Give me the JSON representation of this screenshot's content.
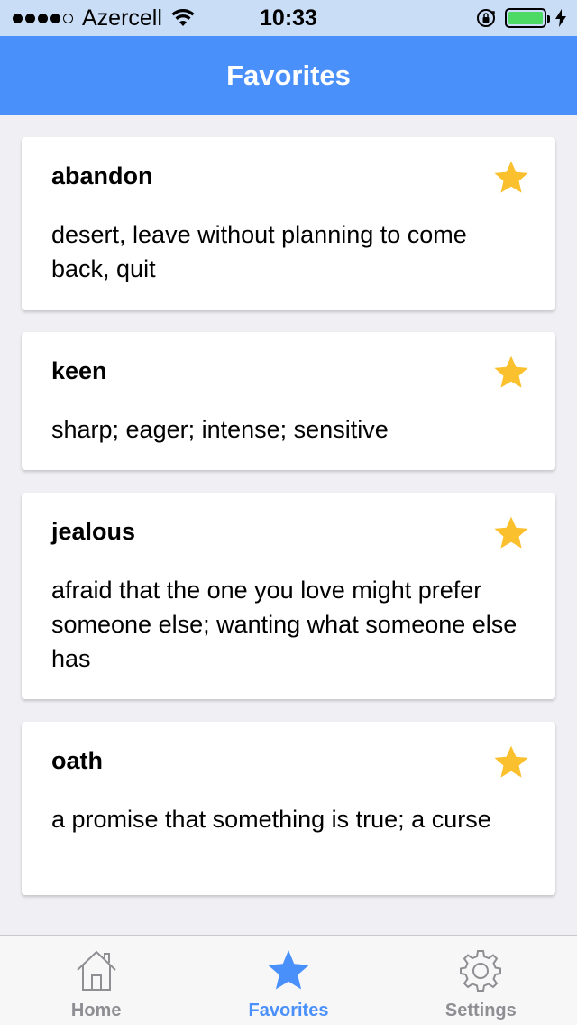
{
  "status_bar": {
    "carrier": "Azercell",
    "time": "10:33",
    "signal_bars": 4,
    "signal_total": 5,
    "battery_level": 1.0
  },
  "nav": {
    "title": "Favorites"
  },
  "cards": [
    {
      "word": "abandon",
      "definition": "desert, leave without planning to come back, quit",
      "favorite": true
    },
    {
      "word": "keen",
      "definition": "sharp; eager; intense; sensitive",
      "favorite": true
    },
    {
      "word": "jealous",
      "definition": "afraid that the one you love might prefer someone else; wanting what someone else has",
      "favorite": true
    },
    {
      "word": "oath",
      "definition": "a promise that something is true; a curse",
      "favorite": true
    }
  ],
  "tabs": [
    {
      "label": "Home",
      "icon": "home-icon",
      "active": false
    },
    {
      "label": "Favorites",
      "icon": "star-icon",
      "active": true
    },
    {
      "label": "Settings",
      "icon": "gear-icon",
      "active": false
    }
  ],
  "colors": {
    "accent": "#4a90fb",
    "star": "#fbc02d",
    "inactive": "#8e8e93",
    "status_bar_bg": "#c9ddf7",
    "battery": "#4cd964"
  }
}
